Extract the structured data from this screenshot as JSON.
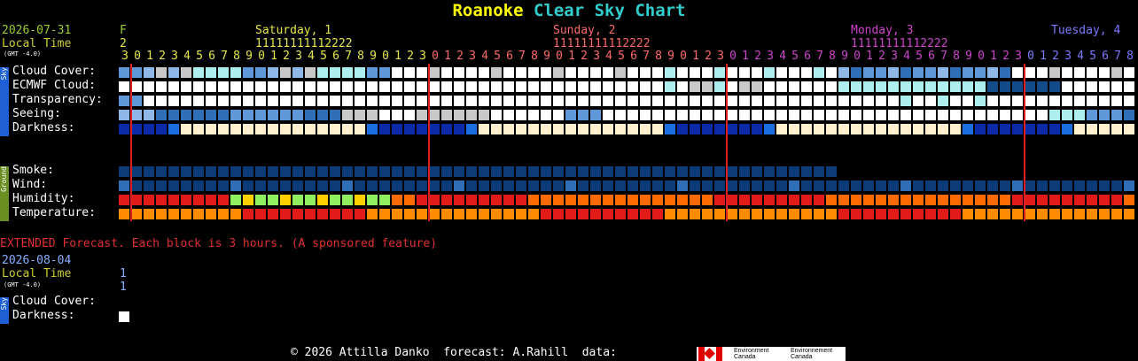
{
  "page": {
    "title_place": "Roanoke",
    "title_rest": " Clear Sky Chart"
  },
  "header": {
    "date": "2026-07-31",
    "local_time": "Local Time",
    "gmt": "(GMT -4.0)",
    "first_col_top": "F",
    "first_col_mid": "2",
    "days": [
      {
        "label": "Saturday, 1",
        "color": "#e6e64c"
      },
      {
        "label": "Sunday, 2",
        "color": "#ff6a6a"
      },
      {
        "label": "Monday, 3",
        "color": "#cc44cc"
      },
      {
        "label": "Tuesday, 4",
        "color": "#7b7bff"
      }
    ],
    "tens_row": "11111111112222",
    "hour_digits": "30123456789012345678901230123456789012345678901230123456789012345678901230123456789012345678901230123456789012345678901230123456789012345678",
    "colors": {
      "date": "#9acd32",
      "local_time": "#cccc33",
      "first_days": "#e6e64c",
      "digits_default": "#e6e64c"
    }
  },
  "sections": {
    "sky": {
      "label": "Sky",
      "color": "#1e5fd6"
    },
    "ground": {
      "label": "Ground",
      "color": "#6b8e23"
    }
  },
  "rows": [
    {
      "label": "Cloud Cover:"
    },
    {
      "label": "ECMWF Cloud:"
    },
    {
      "label": "Transparency:"
    },
    {
      "label": "Seeing:"
    },
    {
      "label": "Darkness:"
    },
    {
      "label": "Smoke:"
    },
    {
      "label": "Wind:"
    },
    {
      "label": "Humidity:"
    },
    {
      "label": "Temperature:"
    }
  ],
  "extended": {
    "note": "EXTENDED Forecast. Each block is 3 hours. (A sponsored feature)",
    "date": "2026-08-04",
    "local_time": "Local Time",
    "gmt": "(GMT -4.0)",
    "digit_top": "1",
    "digit_bottom": "1",
    "rows": [
      {
        "label": "Cloud Cover:"
      },
      {
        "label": "Darkness:"
      }
    ]
  },
  "footer": {
    "text": "© 2026 Attilla Danko  forecast: A.Rahill  data:",
    "env_en_1": "Environment",
    "env_en_2": "Canada",
    "env_fr_1": "Environnement",
    "env_fr_2": "Canada"
  },
  "palette": {
    "white": "#ffffff",
    "lightblue": "#aeeeee",
    "blue1": "#8fb8e8",
    "blue2": "#5f97d8",
    "blue3": "#2f6fb8",
    "blue4": "#124a8a",
    "navy": "#0c3b78",
    "gray": "#c8c8c8",
    "dark_sky": "#0a2aa8",
    "twilight": "#1a6ee0",
    "day": "#fff0d0",
    "red": "#e21a1a",
    "orange": "#ff6a00",
    "orange2": "#ff8c00",
    "yellow": "#ffd000",
    "green": "#8fef5f"
  }
}
